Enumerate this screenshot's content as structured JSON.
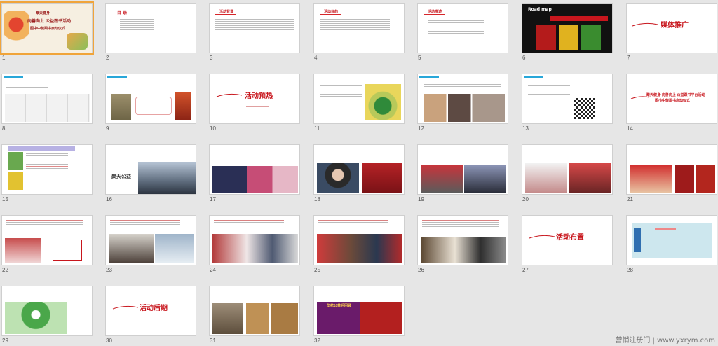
{
  "slides": [
    {
      "n": "1",
      "texts": [
        "聚天健身",
        "向善向上 公益跟书活动",
        "图中中健跟书启动仪式"
      ]
    },
    {
      "n": "2",
      "texts": [
        "目 录"
      ]
    },
    {
      "n": "3",
      "texts": [
        "活动背景"
      ]
    },
    {
      "n": "4",
      "texts": [
        "活动目的"
      ]
    },
    {
      "n": "5",
      "texts": [
        "活动描述"
      ]
    },
    {
      "n": "6",
      "texts": [
        "Road map"
      ]
    },
    {
      "n": "7",
      "texts": [
        "媒体推广"
      ]
    },
    {
      "n": "8",
      "texts": []
    },
    {
      "n": "9",
      "texts": []
    },
    {
      "n": "10",
      "texts": [
        "活动预热"
      ]
    },
    {
      "n": "11",
      "texts": []
    },
    {
      "n": "12",
      "texts": []
    },
    {
      "n": "13",
      "texts": []
    },
    {
      "n": "14",
      "texts": [
        "聚天健身 向善向上 公益跟书平台活动",
        "图小中健跟书启动仪式"
      ]
    },
    {
      "n": "15",
      "texts": []
    },
    {
      "n": "16",
      "texts": [
        "聚天公益"
      ]
    },
    {
      "n": "17",
      "texts": []
    },
    {
      "n": "18",
      "texts": []
    },
    {
      "n": "19",
      "texts": []
    },
    {
      "n": "20",
      "texts": []
    },
    {
      "n": "21",
      "texts": []
    },
    {
      "n": "22",
      "texts": []
    },
    {
      "n": "23",
      "texts": []
    },
    {
      "n": "24",
      "texts": []
    },
    {
      "n": "25",
      "texts": []
    },
    {
      "n": "26",
      "texts": []
    },
    {
      "n": "27",
      "texts": [
        "活动布置"
      ]
    },
    {
      "n": "28",
      "texts": []
    },
    {
      "n": "29",
      "texts": []
    },
    {
      "n": "30",
      "texts": [
        "活动后期"
      ]
    },
    {
      "n": "31",
      "texts": []
    },
    {
      "n": "32",
      "texts": [
        "华杭公益后回顾"
      ]
    }
  ],
  "watermark": "营销注册门 | www.yxrym.com",
  "colors": {
    "accent": "#c8161d",
    "selected": "#f0a43a",
    "tag": "#28a7d9"
  }
}
